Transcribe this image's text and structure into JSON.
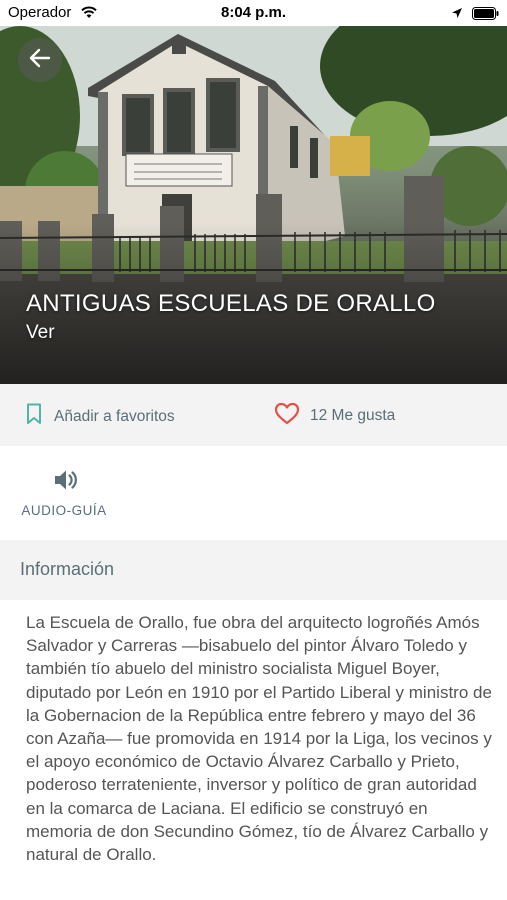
{
  "status_bar": {
    "carrier": "Operador",
    "time": "8:04 p.m."
  },
  "hero": {
    "title": "ANTIGUAS ESCUELAS DE ORALLO",
    "subtitle": "Ver"
  },
  "actions": {
    "favorite_label": "Añadir a favoritos",
    "likes_label": "12 Me gusta"
  },
  "audio": {
    "label": "AUDIO-GUÍA"
  },
  "info": {
    "header": "Información",
    "text": "La Escuela de Orallo, fue obra del arquitecto logroñés Amós Salvador y Carreras —bisabuelo del pintor Álvaro Toledo y también tío abuelo del ministro socialista Miguel Boyer, diputado por León en 1910 por el Partido Liberal y ministro de la Gobernacion de la República entre febrero y mayo del 36 con Azaña— fue promovida en 1914 por la Liga, los vecinos y el apoyo económico de Octavio Álvarez Carballo y Prieto, poderoso terrateniente, inversor y político de gran autoridad en la comarca de Laciana. El edificio se construyó en memoria de don Secundino Gómez, tío de Álvarez Carballo y natural de Orallo."
  },
  "colors": {
    "accent_teal": "#54b3a8",
    "heart_red": "#e4504a",
    "muted_text": "#5a6f77",
    "section_bg": "#f3f3f3"
  },
  "icons": {
    "wifi": "wifi-icon",
    "location": "location-arrow-icon",
    "battery": "battery-icon",
    "back": "arrow-left-icon",
    "bookmark": "bookmark-icon",
    "heart": "heart-icon",
    "speaker": "speaker-icon"
  }
}
